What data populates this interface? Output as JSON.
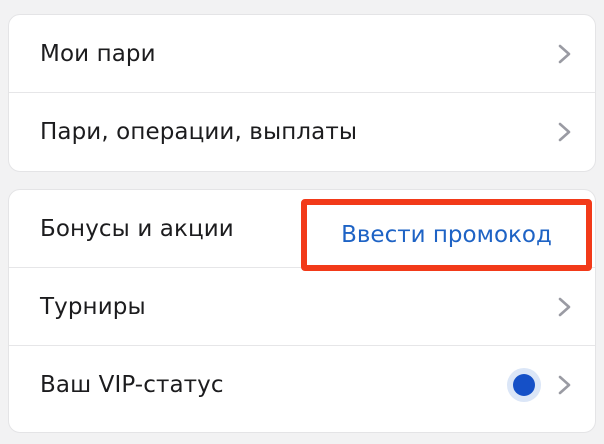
{
  "menu_group_1": {
    "items": [
      {
        "label": "Мои пари"
      },
      {
        "label": "Пари, операции, выплаты"
      }
    ]
  },
  "menu_group_2": {
    "bonuses": {
      "label": "Бонусы и акции",
      "promo_link": "Ввести промокод"
    },
    "tournaments": {
      "label": "Турниры"
    },
    "vip": {
      "label": "Ваш VIP-статус"
    }
  },
  "colors": {
    "highlight_border": "#f23a19",
    "link": "#1e63c5",
    "status_dot": "#1550c7",
    "chevron": "#9a9ba3"
  },
  "icons": {
    "chevron": "chevron-right-icon",
    "status": "status-dot-icon"
  }
}
